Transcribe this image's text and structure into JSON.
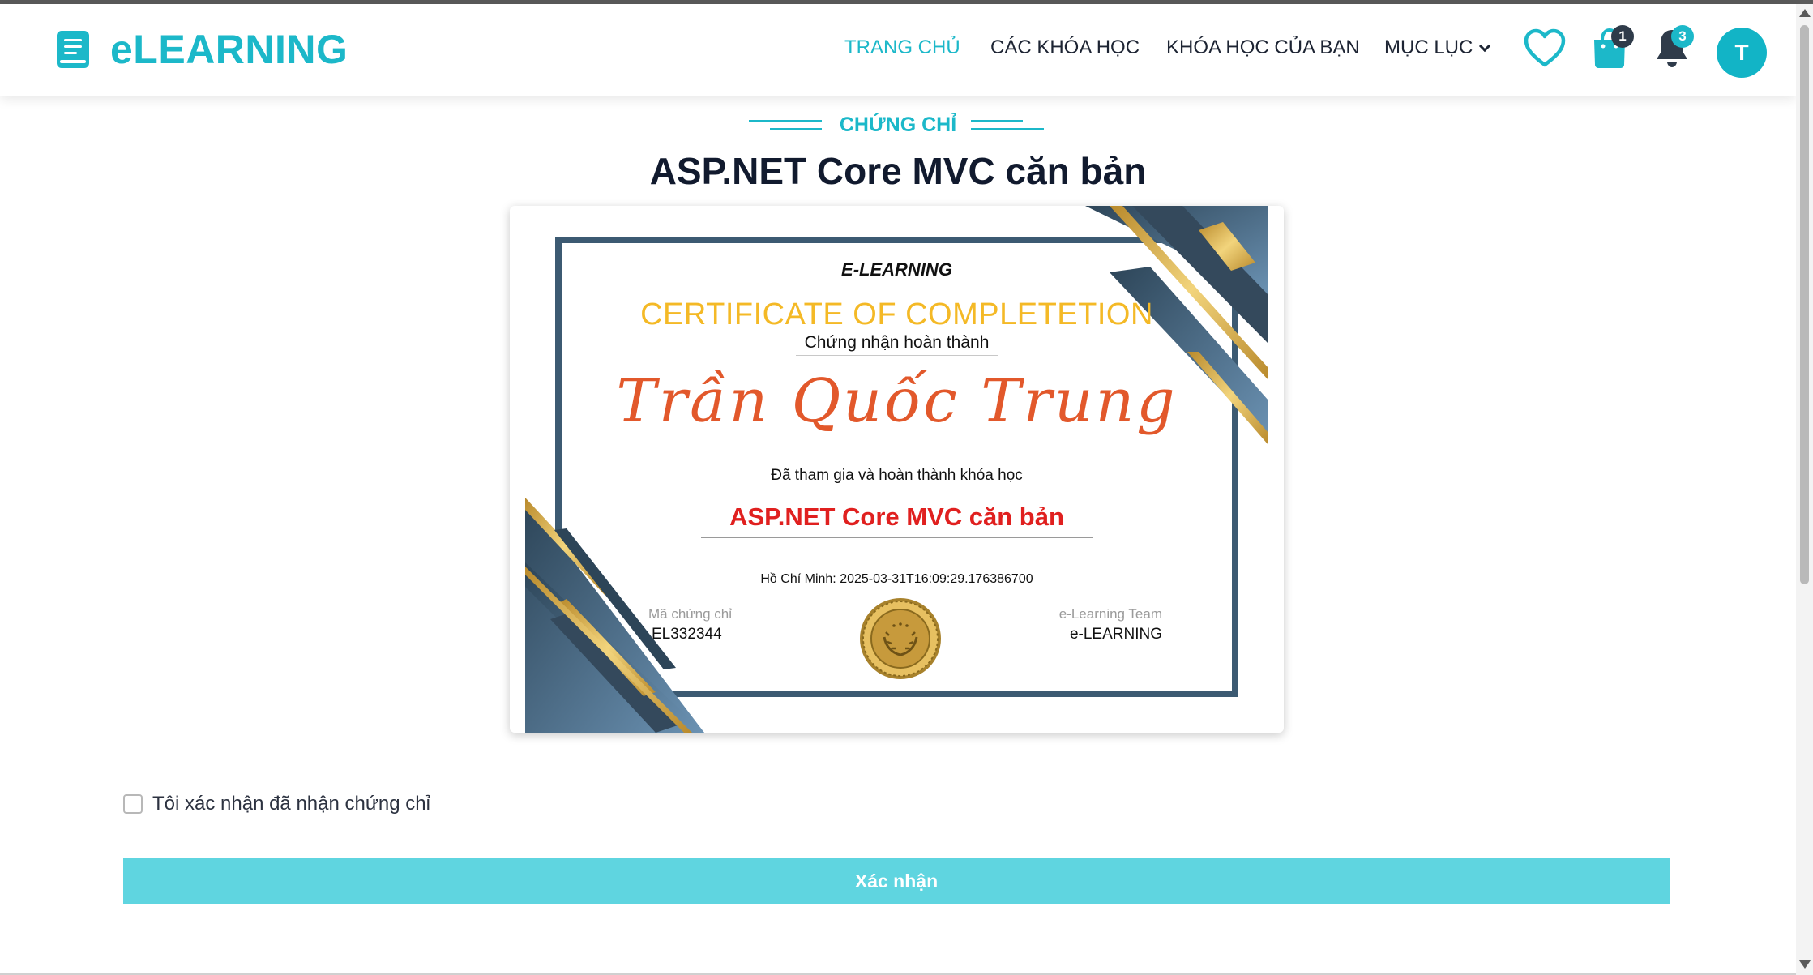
{
  "app": {
    "name": "eLEARNING",
    "brand_color": "#1cb8c9"
  },
  "nav": {
    "items": [
      {
        "label": "TRANG CHỦ",
        "active": true
      },
      {
        "label": "CÁC KHÓA HỌC",
        "active": false
      },
      {
        "label": "KHÓA HỌC CỦA BẠN",
        "active": false
      },
      {
        "label": "MỤC LỤC",
        "active": false,
        "has_dropdown": true
      }
    ],
    "wishlist_icon": "heart-icon",
    "cart": {
      "icon": "shopping-bag-icon",
      "count": "1"
    },
    "notifications": {
      "icon": "bell-icon",
      "count": "3"
    },
    "avatar_initial": "T"
  },
  "section": {
    "label": "CHỨNG CHỈ",
    "title": "ASP.NET Core MVC căn bản"
  },
  "certificate": {
    "brand": "E-LEARNING",
    "title": "CERTIFICATE OF COMPLETETION",
    "subtitle": "Chứng nhận hoàn thành",
    "recipient": "Trần Quốc Trung",
    "description": "Đã tham gia và hoàn thành khóa học",
    "course": "ASP.NET Core MVC căn bản",
    "date_line": "Hồ Chí Minh: 2025-03-31T16:09:29.176386700",
    "code_label": "Mã chứng chỉ",
    "code": "EL332344",
    "team_label": "e-Learning Team",
    "team": "e-LEARNING",
    "seal_icon": "gold-seal-icon",
    "colors": {
      "title": "#f4b926",
      "name": "#e2582b",
      "course": "#e0201f",
      "frame": "#3c5a72",
      "gold": "#d4a83a"
    }
  },
  "confirm": {
    "checkbox_label": "Tôi xác nhận đã nhận chứng chỉ",
    "checked": false,
    "button_label": "Xác nhận",
    "button_color": "#5fd5e0"
  }
}
